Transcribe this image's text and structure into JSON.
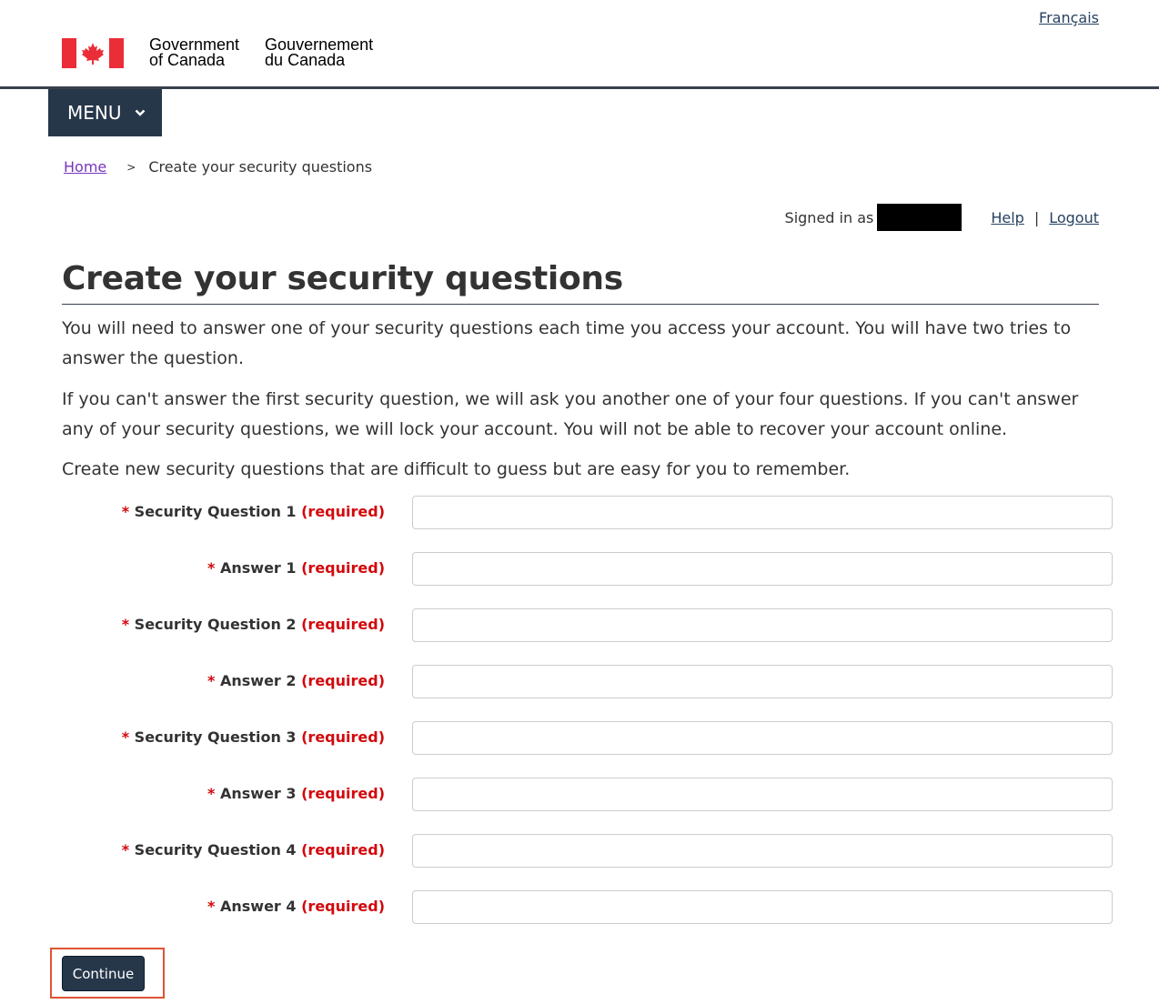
{
  "header": {
    "language_link": "Français",
    "signature_en_line1": "Government",
    "signature_en_line2": "of Canada",
    "signature_fr_line1": "Gouvernement",
    "signature_fr_line2": "du Canada",
    "flag_color": "#eb2d37",
    "menu_label": "MENU"
  },
  "breadcrumb": {
    "home": "Home",
    "separator": ">",
    "current": "Create your security questions"
  },
  "session": {
    "signed_in_label": "Signed in as",
    "help": "Help",
    "divider": "|",
    "logout": "Logout"
  },
  "main": {
    "title": "Create your security questions",
    "para1": "You will need to answer one of your security questions each time you access your account. You will have two tries to answer the question.",
    "para2": "If you can't answer the first security question, we will ask you another one of your four questions. If you can't answer any of your security questions, we will lock your account.  You will not be able to recover your account online.",
    "para3": "Create new security questions that are difficult to guess but are easy for you to remember."
  },
  "form": {
    "required_marker": "*",
    "required_text": "(required)",
    "fields": [
      {
        "label": "Security Question 1",
        "value": ""
      },
      {
        "label": "Answer 1",
        "value": ""
      },
      {
        "label": "Security Question 2",
        "value": ""
      },
      {
        "label": "Answer 2",
        "value": ""
      },
      {
        "label": "Security Question 3",
        "value": ""
      },
      {
        "label": "Answer 3",
        "value": ""
      },
      {
        "label": "Security Question 4",
        "value": ""
      },
      {
        "label": "Answer 4",
        "value": ""
      }
    ],
    "continue_label": "Continue",
    "highlight_color": "#e05333"
  }
}
